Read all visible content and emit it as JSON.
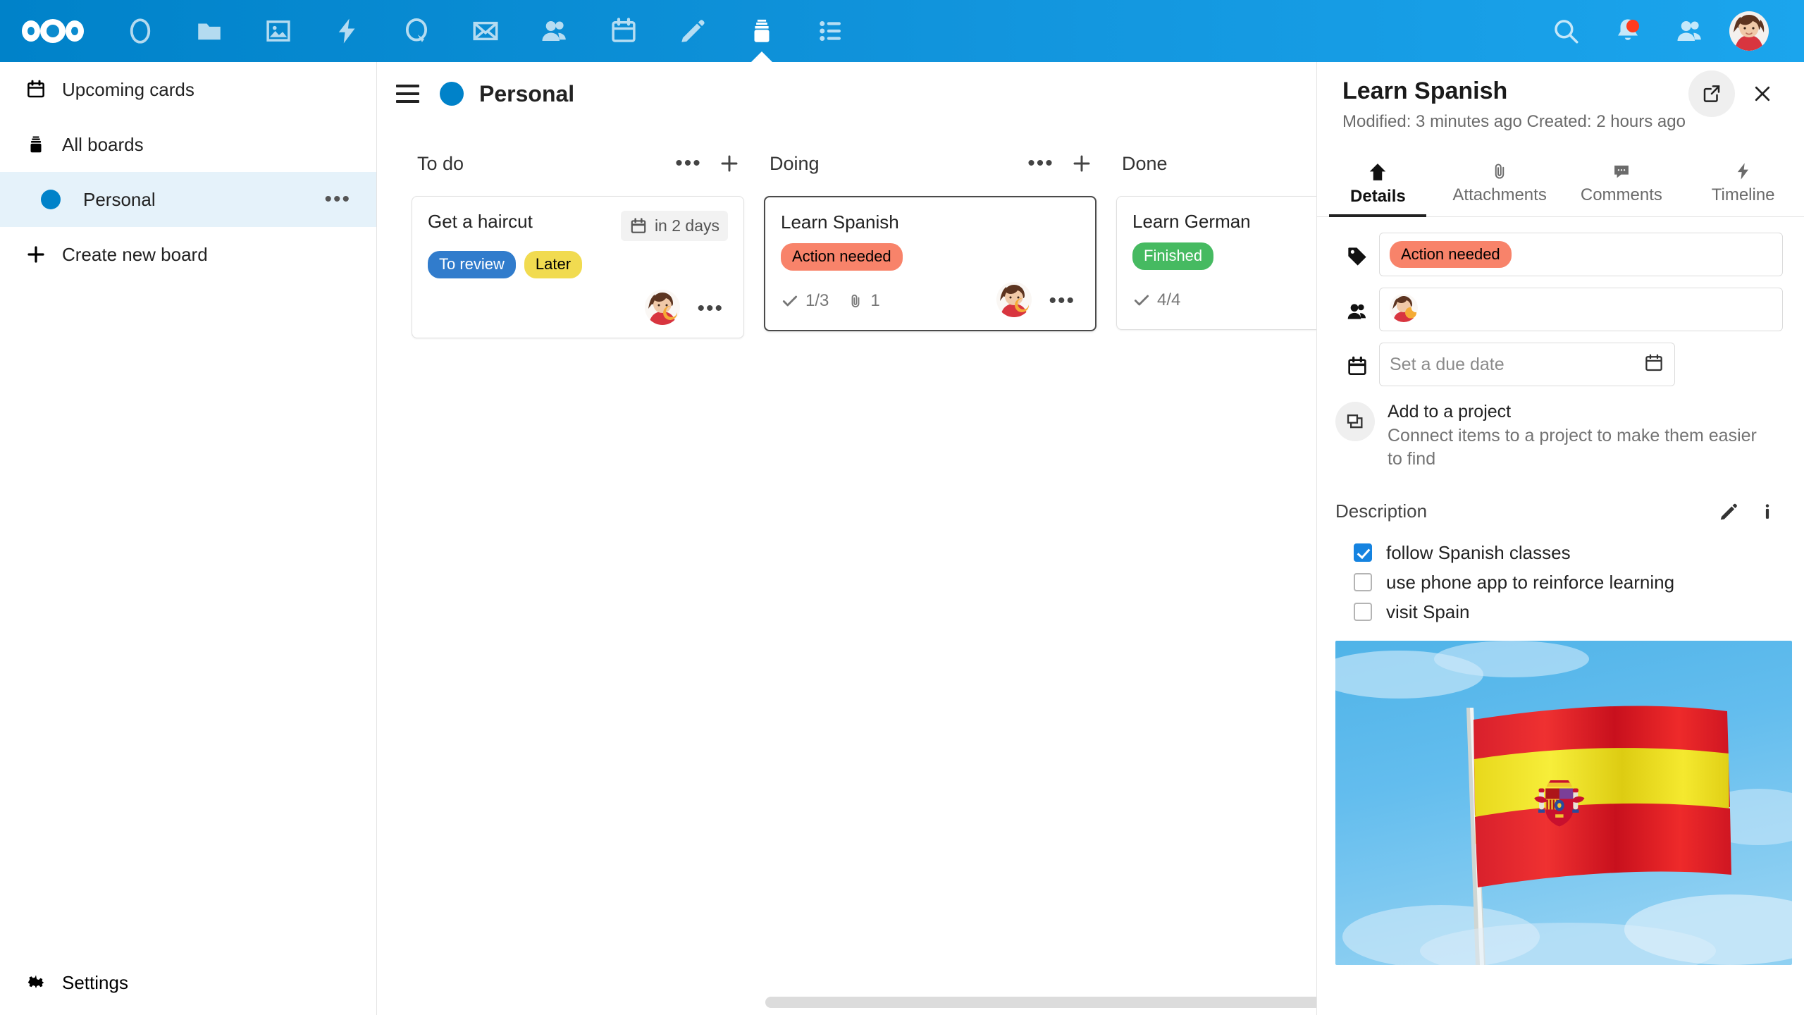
{
  "topnav": {
    "logo_name": "nextcloud-logo",
    "apps": [
      {
        "name": "dashboard",
        "icon": "circle-icon",
        "active": false
      },
      {
        "name": "files",
        "icon": "folder-icon",
        "active": false
      },
      {
        "name": "photos",
        "icon": "photos-icon",
        "active": false
      },
      {
        "name": "activity",
        "icon": "lightning-icon",
        "active": false
      },
      {
        "name": "talk",
        "icon": "talk-icon",
        "active": false
      },
      {
        "name": "mail",
        "icon": "mail-icon",
        "active": false
      },
      {
        "name": "contacts",
        "icon": "contacts-icon",
        "active": false
      },
      {
        "name": "calendar",
        "icon": "calendar-icon",
        "active": false
      },
      {
        "name": "notes",
        "icon": "pencil-icon",
        "active": false
      },
      {
        "name": "deck",
        "icon": "deck-icon",
        "active": true
      },
      {
        "name": "tasks",
        "icon": "list-icon",
        "active": false
      }
    ],
    "right": [
      {
        "name": "search",
        "icon": "search-icon"
      },
      {
        "name": "notifications",
        "icon": "bell-icon",
        "badge": true
      },
      {
        "name": "contacts-menu",
        "icon": "user-icon"
      }
    ],
    "avatar_name": "user-avatar"
  },
  "sidebar": {
    "items": [
      {
        "label": "Upcoming cards",
        "icon": "calendar-icon"
      },
      {
        "label": "All boards",
        "icon": "deck-icon"
      }
    ],
    "boards": [
      {
        "label": "Personal",
        "color": "#0082c9",
        "selected": true,
        "menu": "•••"
      }
    ],
    "create_board_label": "Create new board",
    "settings_label": "Settings"
  },
  "board": {
    "title": "Personal",
    "dot_color": "#0082c9",
    "tools": [
      {
        "name": "add-card",
        "icon": "plus-icon"
      },
      {
        "name": "filter",
        "icon": "filter-icon"
      },
      {
        "name": "board-menu",
        "icon": "dots-icon"
      },
      {
        "name": "board-details",
        "icon": "details-icon"
      }
    ],
    "columns": [
      {
        "title": "To do",
        "menu": "•••",
        "cards": [
          {
            "title": "Get a haircut",
            "due": "in 2 days",
            "due_icon": "calendar-icon",
            "tags": [
              {
                "label": "To review",
                "bg": "#317ccc",
                "fg": "#ffffff"
              },
              {
                "label": "Later",
                "bg": "#f1db50",
                "fg": "#000000"
              }
            ],
            "stats": [],
            "has_avatar": true,
            "selected": false
          }
        ]
      },
      {
        "title": "Doing",
        "menu": "•••",
        "cards": [
          {
            "title": "Learn Spanish",
            "due": "",
            "tags": [
              {
                "label": "Action needed",
                "bg": "#f8836a",
                "fg": "#000000"
              }
            ],
            "stats": [
              {
                "icon": "check-icon",
                "value": "1/3"
              },
              {
                "icon": "paperclip-icon",
                "value": "1"
              }
            ],
            "has_avatar": true,
            "selected": true
          }
        ]
      },
      {
        "title": "Done",
        "menu": "•••",
        "cards": [
          {
            "title": "Learn German",
            "due": "",
            "tags": [
              {
                "label": "Finished",
                "bg": "#46ba61",
                "fg": "#ffffff"
              }
            ],
            "stats": [
              {
                "icon": "check-icon",
                "value": "4/4"
              }
            ],
            "has_avatar": false,
            "selected": false
          }
        ]
      }
    ]
  },
  "panel": {
    "title": "Learn Spanish",
    "subtitle": "Modified: 3 minutes ago Created: 2 hours ago",
    "actions": [
      {
        "name": "open-in-new",
        "icon": "external-link-icon"
      },
      {
        "name": "close",
        "icon": "close-icon"
      }
    ],
    "tabs": [
      {
        "label": "Details",
        "icon": "home-icon",
        "active": true
      },
      {
        "label": "Attachments",
        "icon": "paperclip-icon",
        "active": false
      },
      {
        "label": "Comments",
        "icon": "comment-icon",
        "active": false
      },
      {
        "label": "Timeline",
        "icon": "lightning-icon",
        "active": false
      }
    ],
    "tag_field": {
      "icon": "tag-icon",
      "tags": [
        {
          "label": "Action needed",
          "bg": "#f8836a",
          "fg": "#000000"
        }
      ]
    },
    "assignee_field": {
      "icon": "assignees-icon",
      "has_avatar": true
    },
    "due_field": {
      "icon": "calendar-icon",
      "placeholder": "Set a due date",
      "value": "",
      "picker_icon": "calendar-icon"
    },
    "project": {
      "icon": "project-icon",
      "title": "Add to a project",
      "description": "Connect items to a project to make them easier to find"
    },
    "description": {
      "label": "Description",
      "edit_icon": "pencil-icon",
      "info_icon": "info-icon",
      "checklist": [
        {
          "label": "follow Spanish classes",
          "checked": true
        },
        {
          "label": "use phone app to reinforce learning",
          "checked": false
        },
        {
          "label": "visit Spain",
          "checked": false
        }
      ],
      "image_name": "spanish-flag-photo"
    }
  }
}
